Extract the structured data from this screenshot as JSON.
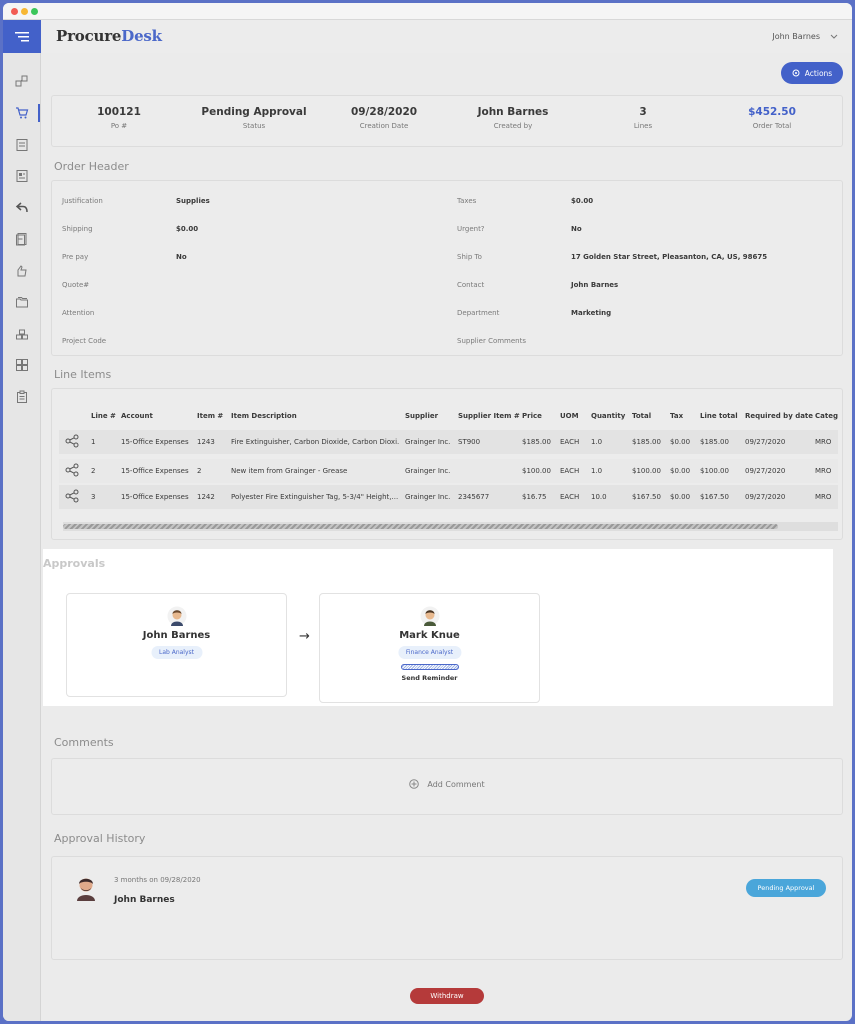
{
  "app": {
    "logo_procure": "Procure",
    "logo_desk": "Desk",
    "user_name": "John Barnes"
  },
  "colors": {
    "brand": "#4361c9",
    "pending": "#4aa6da",
    "withdraw": "#b53a3a",
    "mac_close": "#f25c54",
    "mac_min": "#f7b733",
    "mac_max": "#3bc65a"
  },
  "sidebar": {
    "icons": [
      "requisitions-icon",
      "cart-icon",
      "invoice-icon",
      "receipt-icon",
      "return-icon",
      "documents-icon",
      "approvals-icon",
      "folders-icon",
      "inventory-icon",
      "dashboard-icon",
      "clipboard-icon"
    ]
  },
  "toolbar": {
    "actions_label": "Actions"
  },
  "summary": [
    {
      "value": "100121",
      "label": "Po #"
    },
    {
      "value": "Pending Approval",
      "label": "Status"
    },
    {
      "value": "09/28/2020",
      "label": "Creation Date"
    },
    {
      "value": "John Barnes",
      "label": "Created by"
    },
    {
      "value": "3",
      "label": "Lines"
    },
    {
      "value": "$452.50",
      "label": "Order Total"
    }
  ],
  "order_header": {
    "title": "Order Header",
    "left": [
      {
        "label": "Justification",
        "value": "Supplies"
      },
      {
        "label": "Shipping",
        "value": "$0.00"
      },
      {
        "label": "Pre pay",
        "value": "No"
      },
      {
        "label": "Quote#",
        "value": ""
      },
      {
        "label": "Attention",
        "value": ""
      },
      {
        "label": "Project Code",
        "value": ""
      }
    ],
    "right": [
      {
        "label": "Taxes",
        "value": "$0.00"
      },
      {
        "label": "Urgent?",
        "value": "No"
      },
      {
        "label": "Ship To",
        "value": "17 Golden Star Street, Pleasanton, CA, US, 98675"
      },
      {
        "label": "Contact",
        "value": "John Barnes"
      },
      {
        "label": "Department",
        "value": "Marketing"
      },
      {
        "label": "Supplier Comments",
        "value": ""
      }
    ]
  },
  "line_items": {
    "title": "Line Items",
    "columns": [
      "Line #",
      "Account",
      "Item #",
      "Item Description",
      "Supplier",
      "Supplier Item #",
      "Price",
      "UOM",
      "Quantity",
      "Total",
      "Tax",
      "Line total",
      "Required by date",
      "Categ"
    ],
    "rows": [
      [
        "1",
        "15-Office Expenses",
        "1243",
        "Fire Extinguisher, Carbon Dioxide, Carbon Dioxi...",
        "Grainger Inc.",
        "ST900",
        "$185.00",
        "EACH",
        "1.0",
        "$185.00",
        "$0.00",
        "$185.00",
        "09/27/2020",
        "MRO"
      ],
      [
        "2",
        "15-Office Expenses",
        "2",
        "New item from Grainger - Grease",
        "Grainger Inc.",
        "",
        "$100.00",
        "EACH",
        "1.0",
        "$100.00",
        "$0.00",
        "$100.00",
        "09/27/2020",
        "MRO"
      ],
      [
        "3",
        "15-Office Expenses",
        "1242",
        "Polyester Fire Extinguisher Tag, 5-3/4\" Height,...",
        "Grainger Inc.",
        "2345677",
        "$16.75",
        "EACH",
        "10.0",
        "$167.50",
        "$0.00",
        "$167.50",
        "09/27/2020",
        "MRO"
      ]
    ]
  },
  "approvals": {
    "title": "Approvals",
    "approvers": [
      {
        "name": "John Barnes",
        "role": "Lab Analyst"
      },
      {
        "name": "Mark Knue",
        "role": "Finance Analyst",
        "reminder": "Send Reminder"
      }
    ],
    "arrow": "→"
  },
  "comments": {
    "title": "Comments",
    "add_label": "Add Comment"
  },
  "history": {
    "title": "Approval History",
    "entries": [
      {
        "date": "3 months on 09/28/2020",
        "name": "John Barnes",
        "status": "Pending Approval"
      }
    ]
  },
  "footer": {
    "withdraw_label": "Withdraw"
  }
}
